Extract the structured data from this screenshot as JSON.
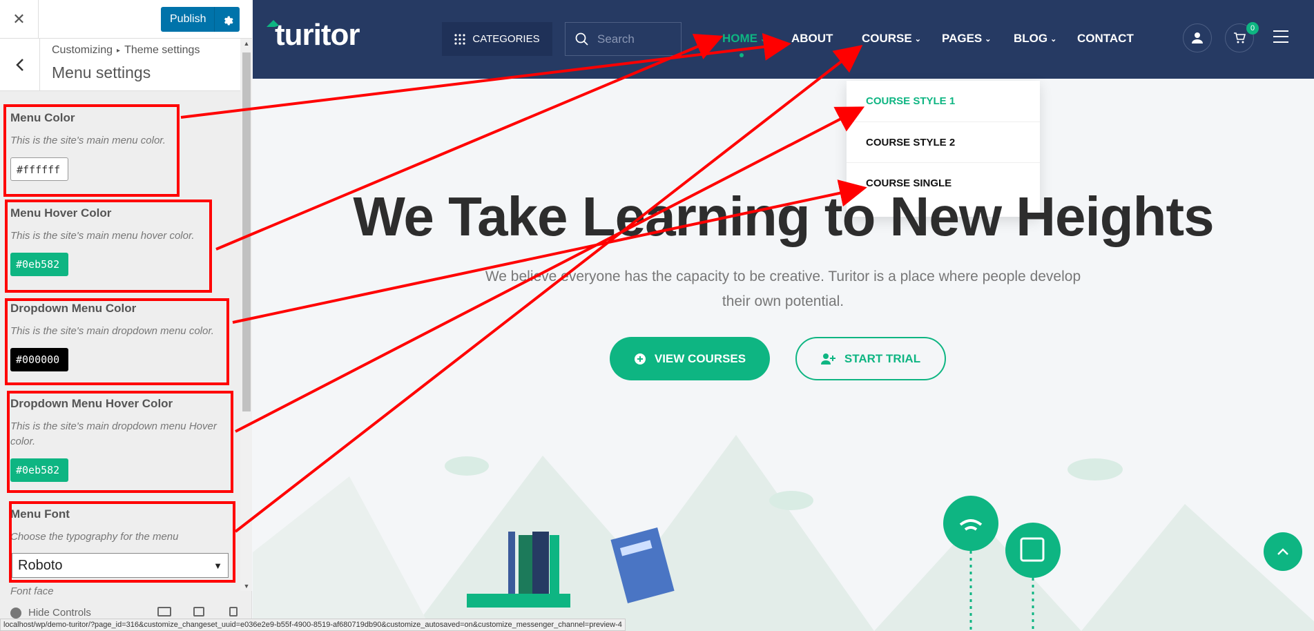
{
  "customizer": {
    "publish_label": "Publish",
    "breadcrumb": [
      "Customizing",
      "Theme settings"
    ],
    "panel_title": "Menu settings",
    "controls": [
      {
        "title": "Menu Color",
        "description": "This is the site's main menu color.",
        "value": "#ffffff",
        "swatch_color": "#ffffff"
      },
      {
        "title": "Menu Hover Color",
        "description": "This is the site's main menu hover color.",
        "value": "#0eb582",
        "swatch_color": "#0eb582"
      },
      {
        "title": "Dropdown Menu Color",
        "description": "This is the site's main dropdown menu color.",
        "value": "#000000",
        "swatch_color": "#000000"
      },
      {
        "title": "Dropdown Menu Hover Color",
        "description": "This is the site's main dropdown menu Hover color.",
        "value": "#0eb582",
        "swatch_color": "#0eb582"
      },
      {
        "title": "Menu Font",
        "description": "Choose the typography for the menu",
        "value": "Roboto"
      }
    ],
    "font_face_label": "Font face",
    "hide_controls_label": "Hide Controls"
  },
  "site": {
    "logo_text": "turitor",
    "categories_label": "CATEGORIES",
    "search_placeholder": "Search",
    "nav": [
      "HOME",
      "ABOUT",
      "COURSE",
      "PAGES",
      "BLOG",
      "CONTACT"
    ],
    "cart_count": "0",
    "dropdown": [
      "COURSE STYLE 1",
      "COURSE STYLE 2",
      "COURSE SINGLE"
    ],
    "hero_title": "We Take Learning to New Heights",
    "hero_subtitle": "We believe everyone has the capacity to be creative. Turitor is a place where people develop their own potential.",
    "btn_view_courses": "VIEW COURSES",
    "btn_start_trial": "START TRIAL"
  },
  "status_url": "localhost/wp/demo-turitor/?page_id=316&customize_changeset_uuid=e036e2e9-b55f-4900-8519-af680719db90&customize_autosaved=on&customize_messenger_channel=preview-4",
  "colors": {
    "accent": "#0eb582",
    "header_bg": "#263a63",
    "publish_blue": "#0073aa",
    "annotation_red": "#ff0000"
  }
}
